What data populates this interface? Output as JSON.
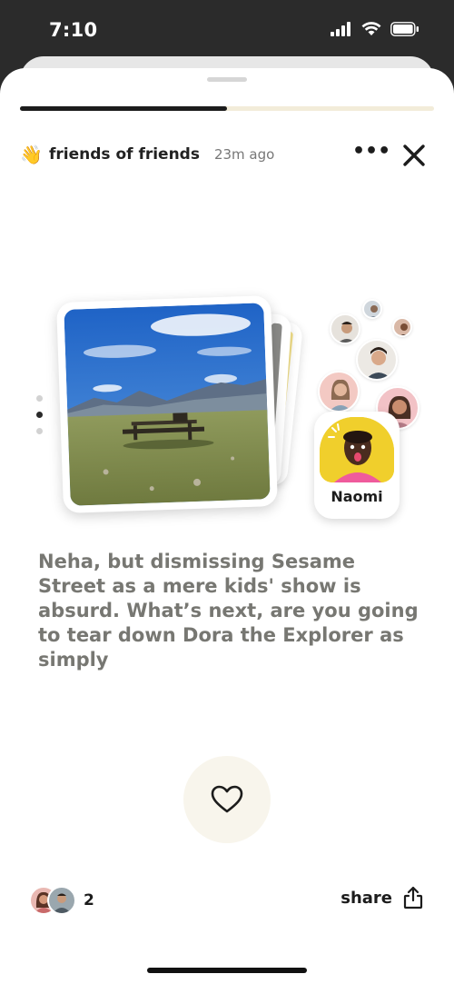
{
  "status_bar": {
    "time": "7:10"
  },
  "story": {
    "progress": 0.5,
    "audience": "friends of friends",
    "time_ago": "23m ago",
    "pager": {
      "count": 3,
      "active": 1
    }
  },
  "responder": {
    "name": "Naomi"
  },
  "post": {
    "text": "Neha, but dismissing Sesame Street as a mere kids' show is absurd. What’s next, are you going to tear down Dora the Explorer as simply"
  },
  "footer": {
    "like_count": "2",
    "share_label": "share"
  },
  "icons": {
    "wave": "waving-hand-icon",
    "more": "more-dots-icon",
    "close": "close-icon",
    "like": "heart-icon",
    "share": "share-icon"
  },
  "colors": {
    "progress_fill": "#1c1c1c",
    "progress_track": "#f2ecd9",
    "naomi_background": "#f0cf2c",
    "like_button_bg": "#f8f5ec"
  }
}
